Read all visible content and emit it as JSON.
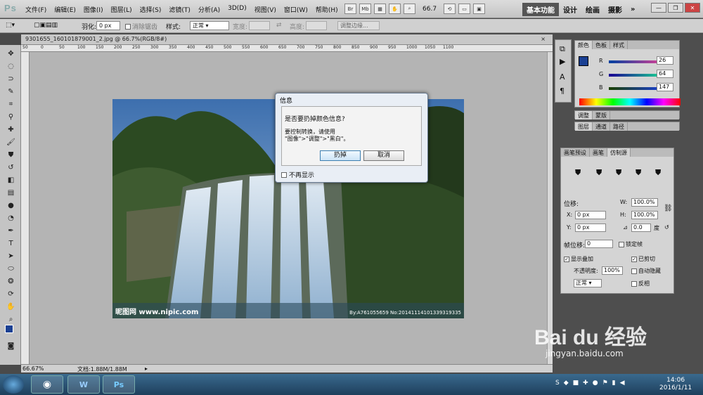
{
  "app": {
    "logo": "Ps"
  },
  "menu": [
    "文件(F)",
    "编辑(E)",
    "图像(I)",
    "图层(L)",
    "选择(S)",
    "滤镜(T)",
    "分析(A)",
    "3D(D)",
    "视图(V)",
    "窗口(W)",
    "帮助(H)"
  ],
  "topbar": {
    "br": "Br",
    "mb": "Mb",
    "zoom": "66.7",
    "workspaces": [
      "基本功能",
      "设计",
      "绘画",
      "摄影"
    ],
    "more": "»"
  },
  "options": {
    "feather_label": "羽化:",
    "feather_value": "0 px",
    "antialias": "消除锯齿",
    "style_label": "样式:",
    "style_value": "正常",
    "width_label": "宽度:",
    "height_label": "高度:",
    "refine": "调整边缘..."
  },
  "document": {
    "tab": "9301655_160101879001_2.jpg @ 66.7%(RGB/8#)",
    "close": "×",
    "watermark_left": "昵图网 www.nipic.com",
    "watermark_right": "By:A761055659 No:20141114101339319335"
  },
  "ruler": [
    "50",
    "0",
    "50",
    "100",
    "150",
    "200",
    "250",
    "300",
    "350",
    "400",
    "450",
    "500",
    "550",
    "600",
    "650",
    "700",
    "750",
    "800",
    "850",
    "900",
    "950",
    "1000",
    "1050",
    "1100"
  ],
  "status": {
    "zoom": "66.67%",
    "doc": "文档:1.88M/1.88M"
  },
  "dialog": {
    "title": "信息",
    "question": "是否要扔掉颜色信息?",
    "line1": "要控制转换，请使用",
    "line2": "\"图像\">\"调整\">\"黑白\"。",
    "ok": "扔掉",
    "cancel": "取消",
    "dont_show": "不再显示"
  },
  "color_panel": {
    "tabs": [
      "颜色",
      "色板",
      "样式"
    ],
    "r_label": "R",
    "g_label": "G",
    "b_label": "B",
    "r": "26",
    "g": "64",
    "b": "147",
    "fg": "#1a4093",
    "bg": "#e07b1c"
  },
  "adjust_tabs": [
    "调整",
    "蒙版"
  ],
  "layer_tabs": [
    "图层",
    "通道",
    "路径"
  ],
  "clone_panel": {
    "tabs": [
      "画笔预设",
      "画笔",
      "仿制源"
    ],
    "offset": "位移:",
    "w_label": "W:",
    "w": "100.0%",
    "h_label": "H:",
    "h": "100.0%",
    "x_label": "X:",
    "x": "0 px",
    "y_label": "Y:",
    "y": "0 px",
    "angle": "0.0",
    "angle_unit": "度",
    "frame_offset": "帧位移:",
    "frame_value": "0",
    "lock_frame": "锁定帧",
    "show_overlay": "显示叠加",
    "clipped": "已剪切",
    "opacity_label": "不透明度:",
    "opacity": "100%",
    "auto_hide": "自动隐藏",
    "mode": "正常",
    "invert": "反相"
  },
  "taskbar": {
    "word": "W",
    "ps": "Ps",
    "time": "14:06",
    "date": "2016/1/11"
  },
  "brand": {
    "baidu": "Bai du 经验",
    "url": "jingyan.baidu.com"
  }
}
